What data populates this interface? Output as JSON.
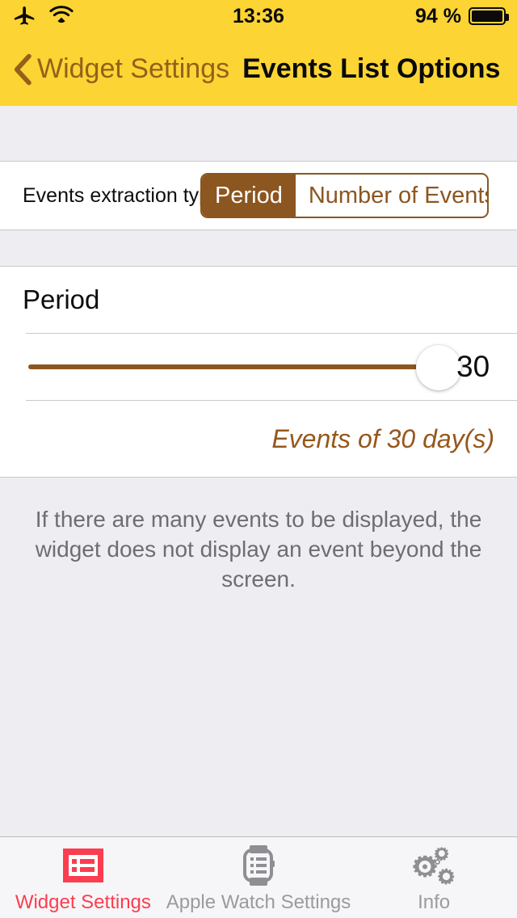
{
  "status_bar": {
    "airplane_icon": "airplane-icon",
    "wifi_icon": "wifi-icon",
    "time": "13:36",
    "battery_percent": "94 %",
    "battery_icon": "battery-full-icon"
  },
  "nav_bar": {
    "back_icon": "chevron-left-icon",
    "back_label": "Widget Settings",
    "title": "Events List Options",
    "background_color": "#fcd434",
    "tint_color": "#936119"
  },
  "settings": {
    "extraction": {
      "label": "Events extraction type",
      "options": [
        "Period",
        "Number of Events"
      ],
      "selected": "Period",
      "accent_color": "#8c5620"
    },
    "period": {
      "title": "Period",
      "slider_value": "30",
      "slider_min": 1,
      "slider_max": 31,
      "slider_percent": 97,
      "caption": "Events of 30 day(s)",
      "caption_color": "#96571b"
    },
    "footer_note": "If there are many events to be displayed, the widget does not display an event beyond the screen."
  },
  "tab_bar": {
    "active_color": "#fc3d4f",
    "inactive_color": "#9a9a9f",
    "items": [
      {
        "label": "Widget Settings",
        "icon": "widget-list-icon",
        "active": true
      },
      {
        "label": "Apple Watch Settings",
        "icon": "apple-watch-icon",
        "active": false
      },
      {
        "label": "Info",
        "icon": "gears-icon",
        "active": false
      }
    ]
  }
}
